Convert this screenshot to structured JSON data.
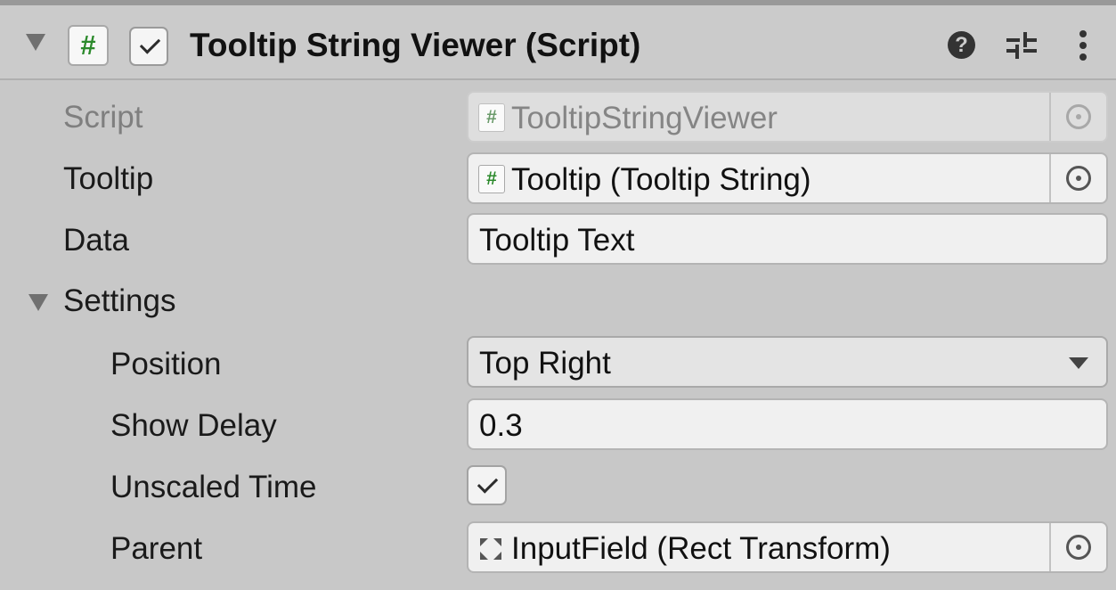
{
  "component": {
    "title": "Tooltip String Viewer (Script)",
    "script_icon_glyph": "#",
    "enabled": true,
    "help_glyph": "?",
    "icons": [
      "foldout-expanded-icon",
      "csharp-script-icon",
      "checkbox-icon",
      "help-icon",
      "presets-icon",
      "context-menu-icon"
    ]
  },
  "properties": {
    "script": {
      "label": "Script",
      "value": "TooltipStringViewer",
      "icon_glyph": "#"
    },
    "tooltip": {
      "label": "Tooltip",
      "value": "Tooltip (Tooltip String)",
      "icon_glyph": "#"
    },
    "data": {
      "label": "Data",
      "value": "Tooltip Text"
    },
    "settings": {
      "label": "Settings",
      "expanded": true,
      "position": {
        "label": "Position",
        "value": "Top Right"
      },
      "show_delay": {
        "label": "Show Delay",
        "value": "0.3"
      },
      "unscaled_time": {
        "label": "Unscaled Time",
        "checked": true
      },
      "parent": {
        "label": "Parent",
        "value": "InputField (Rect Transform)"
      }
    }
  },
  "colors": {
    "panel_bg": "#c8c8c8",
    "field_bg": "#f0f0f0",
    "script_icon_green": "#2c8a2c",
    "disabled_text": "#7f7f7f"
  }
}
